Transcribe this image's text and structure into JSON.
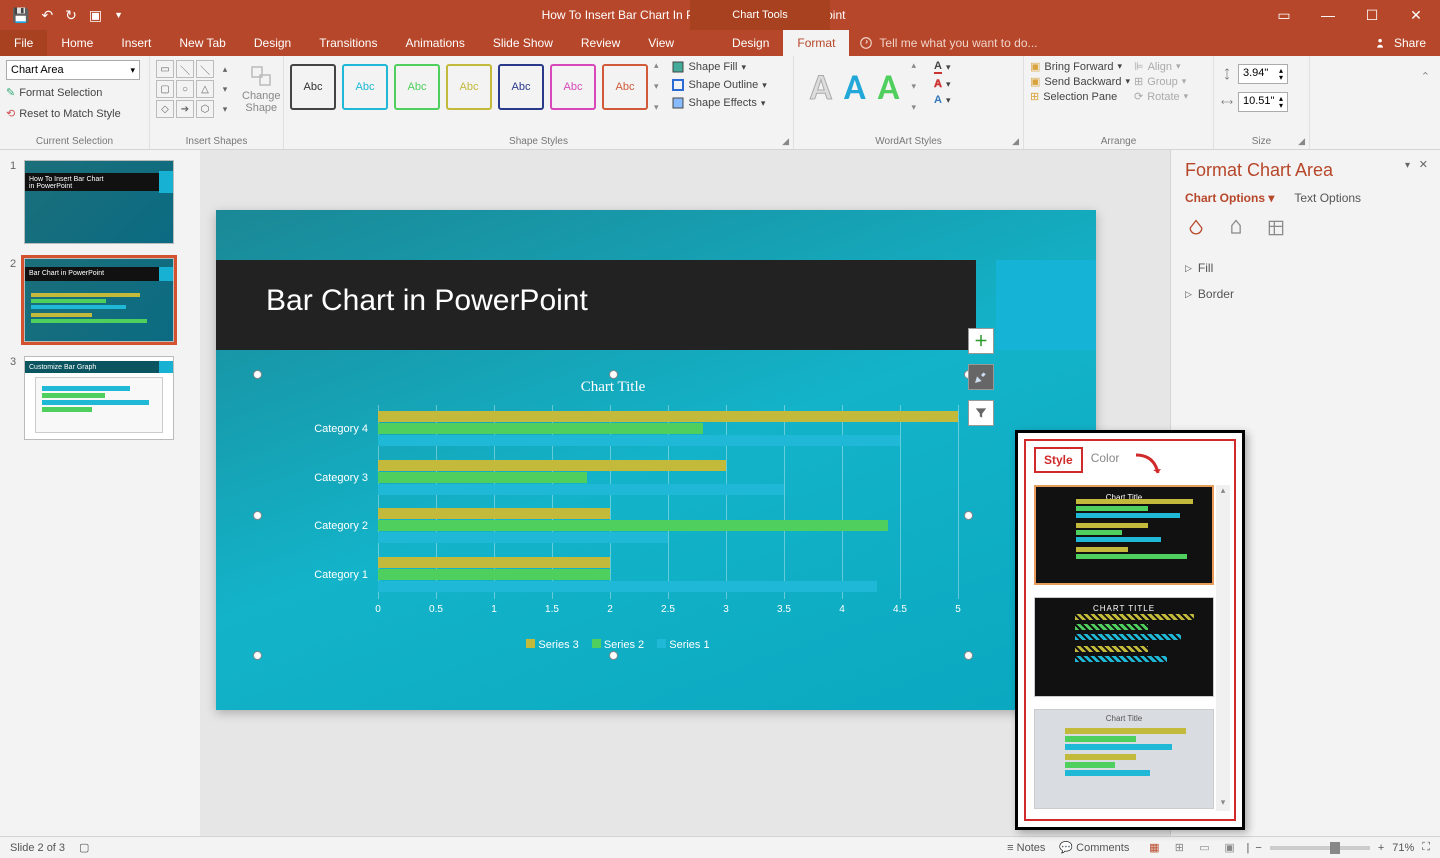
{
  "titlebar": {
    "doc_title": "How To Insert Bar Chart In PowerPoint.pptx - PowerPoint",
    "chart_tools": "Chart Tools"
  },
  "tabs": {
    "file": "File",
    "home": "Home",
    "insert": "Insert",
    "newtab": "New Tab",
    "design": "Design",
    "transitions": "Transitions",
    "animations": "Animations",
    "slideshow": "Slide Show",
    "review": "Review",
    "view": "View",
    "ct_design": "Design",
    "ct_format": "Format",
    "tellme": "Tell me what you want to do...",
    "share": "Share"
  },
  "ribbon": {
    "selection": {
      "label": "Current Selection",
      "combo": "Chart Area",
      "format_sel": "Format Selection",
      "reset": "Reset to Match Style"
    },
    "shapes": {
      "label": "Insert Shapes",
      "change": "Change\nShape"
    },
    "styles": {
      "label": "Shape Styles",
      "abc": "Abc",
      "fill": "Shape Fill",
      "outline": "Shape Outline",
      "effects": "Shape Effects"
    },
    "wordart": {
      "label": "WordArt Styles"
    },
    "arrange": {
      "label": "Arrange",
      "fwd": "Bring Forward",
      "back": "Send Backward",
      "pane": "Selection Pane",
      "align": "Align",
      "group": "Group",
      "rotate": "Rotate"
    },
    "size": {
      "label": "Size",
      "height": "3.94\"",
      "width": "10.51\""
    }
  },
  "thumbs": {
    "t1": "How To Insert Bar Chart\nin PowerPoint",
    "t2": "Bar Chart in PowerPoint",
    "t3": "Customize Bar Graph"
  },
  "slide": {
    "title": "Bar Chart in PowerPoint",
    "chart_title": "Chart Title",
    "legend": {
      "s1": "Series 1",
      "s2": "Series 2",
      "s3": "Series 3"
    }
  },
  "chart_data": {
    "type": "bar",
    "title": "Chart Title",
    "xlabel": "",
    "ylabel": "",
    "xlim": [
      0,
      5
    ],
    "categories": [
      "Category 1",
      "Category 2",
      "Category 3",
      "Category 4"
    ],
    "series": [
      {
        "name": "Series 3",
        "color": "#c3b93b",
        "values": [
          2.0,
          2.0,
          3.0,
          5.0
        ]
      },
      {
        "name": "Series 2",
        "color": "#4fcf5d",
        "values": [
          2.0,
          4.4,
          1.8,
          2.8
        ]
      },
      {
        "name": "Series 1",
        "color": "#1fb8d6",
        "values": [
          4.3,
          2.5,
          3.5,
          4.5
        ]
      }
    ],
    "ticks": [
      0,
      0.5,
      1,
      1.5,
      2,
      2.5,
      3,
      3.5,
      4,
      4.5,
      5
    ]
  },
  "format_pane": {
    "title": "Format Chart Area",
    "opt": "Chart Options",
    "txt": "Text Options",
    "fill": "Fill",
    "border": "Border"
  },
  "style_popup": {
    "style": "Style",
    "color": "Color",
    "ct": "Chart Title",
    "ctu": "CHART TITLE"
  },
  "status": {
    "slide": "Slide 2 of 3",
    "notes": "Notes",
    "comments": "Comments",
    "zoom": "71%"
  }
}
